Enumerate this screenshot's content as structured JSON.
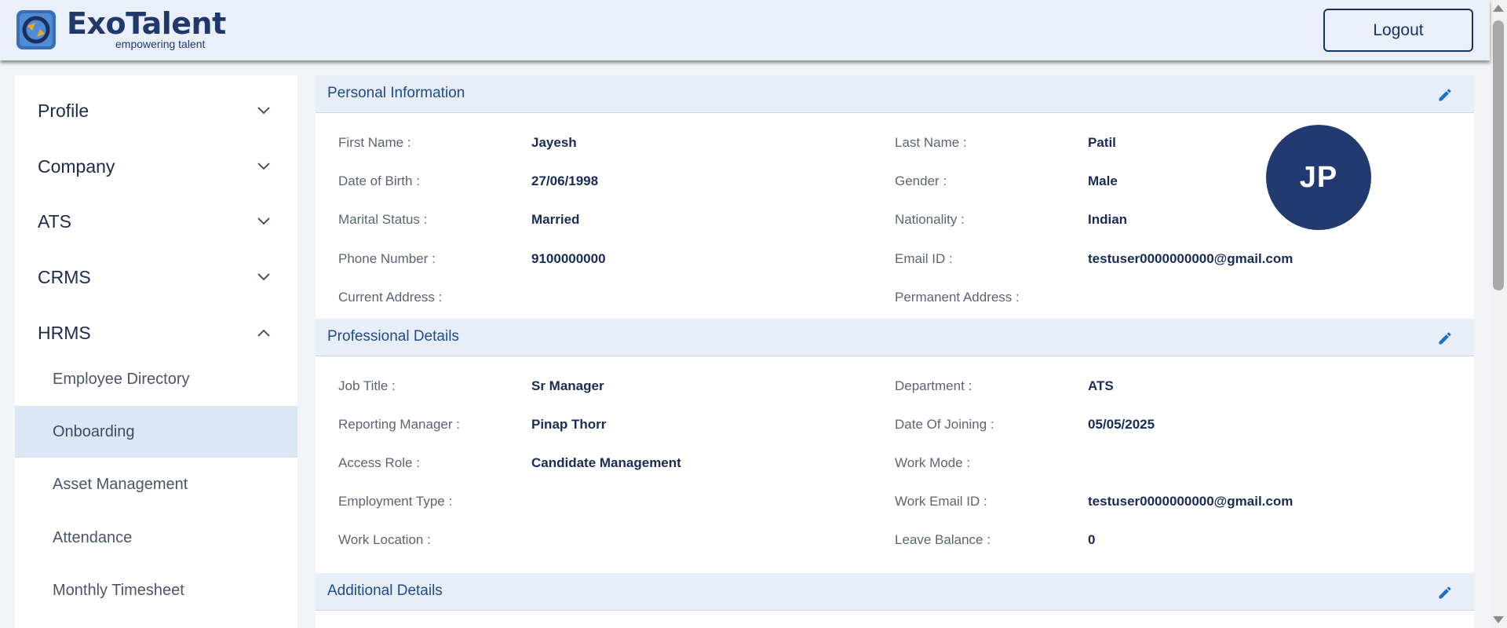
{
  "header": {
    "brand_name": "ExoTalent",
    "brand_tagline": "empowering talent",
    "logout_label": "Logout"
  },
  "sidebar": {
    "items": [
      {
        "label": "Profile",
        "expanded": false
      },
      {
        "label": "Company",
        "expanded": false
      },
      {
        "label": "ATS",
        "expanded": false
      },
      {
        "label": "CRMS",
        "expanded": false
      },
      {
        "label": "HRMS",
        "expanded": true
      }
    ],
    "hrms_subitems": [
      {
        "label": "Employee Directory",
        "active": false
      },
      {
        "label": "Onboarding",
        "active": true
      },
      {
        "label": "Asset Management",
        "active": false
      },
      {
        "label": "Attendance",
        "active": false
      },
      {
        "label": "Monthly Timesheet",
        "active": false
      }
    ]
  },
  "personal": {
    "title": "Personal Information",
    "avatar_initials": "JP",
    "first_name_label": "First Name :",
    "first_name": "Jayesh",
    "last_name_label": "Last Name :",
    "last_name": "Patil",
    "dob_label": "Date of Birth :",
    "dob": "27/06/1998",
    "gender_label": "Gender :",
    "gender": "Male",
    "marital_label": "Marital Status :",
    "marital": "Married",
    "nationality_label": "Nationality :",
    "nationality": "Indian",
    "phone_label": "Phone Number :",
    "phone": "9100000000",
    "email_label": "Email ID :",
    "email": "testuser0000000000@gmail.com",
    "current_address_label": "Current Address :",
    "current_address": "",
    "permanent_address_label": "Permanent Address :",
    "permanent_address": ""
  },
  "professional": {
    "title": "Professional Details",
    "job_title_label": "Job Title :",
    "job_title": "Sr Manager",
    "department_label": "Department :",
    "department": "ATS",
    "reporting_manager_label": "Reporting Manager :",
    "reporting_manager": "Pinap Thorr",
    "doj_label": "Date Of Joining :",
    "doj": "05/05/2025",
    "access_role_label": "Access Role :",
    "access_role": "Candidate Management",
    "work_mode_label": "Work Mode :",
    "work_mode": "",
    "employment_type_label": "Employment Type :",
    "employment_type": "",
    "work_email_label": "Work Email ID :",
    "work_email": "testuser0000000000@gmail.com",
    "work_location_label": "Work Location :",
    "work_location": "",
    "leave_balance_label": "Leave Balance :",
    "leave_balance": "0"
  },
  "additional": {
    "title": "Additional Details"
  },
  "colors": {
    "brand": "#21386b",
    "section_header_bg": "#e7eef8",
    "section_title": "#1f4a8a",
    "active_nav_bg": "#dbe7f5",
    "avatar_bg": "#223a70",
    "edit_icon": "#1a6fc4"
  },
  "icons": {
    "logo": "exotalent-logo-icon",
    "edit": "pencil-icon",
    "chevron_down": "chevron-down-icon",
    "chevron_up": "chevron-up-icon"
  }
}
